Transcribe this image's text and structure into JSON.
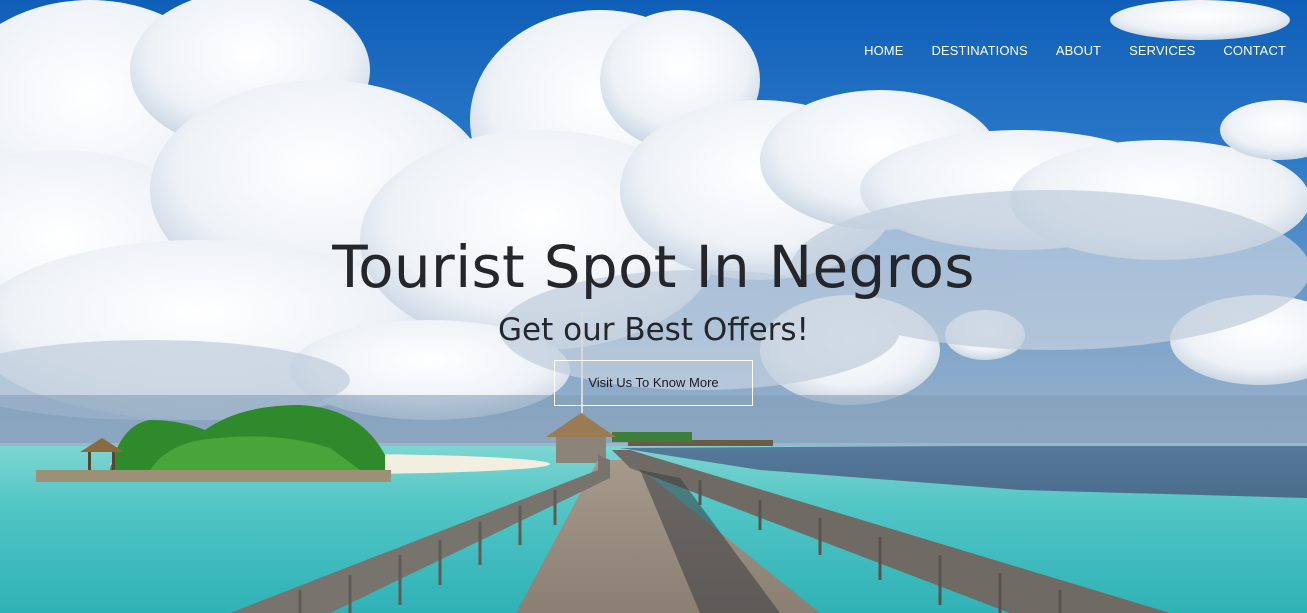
{
  "nav": {
    "items": [
      {
        "label": "HOME"
      },
      {
        "label": "DESTINATIONS"
      },
      {
        "label": "ABOUT"
      },
      {
        "label": "SERVICES"
      },
      {
        "label": "CONTACT"
      }
    ]
  },
  "hero": {
    "title": "Tourist Spot In Negros",
    "subtitle": "Get our Best Offers!",
    "button_label": "Visit Us To Know More"
  },
  "colors": {
    "sky": "#1a6fc4",
    "sea": "#56c9c8",
    "title_text": "#24262b",
    "nav_text": "#ffffff"
  }
}
